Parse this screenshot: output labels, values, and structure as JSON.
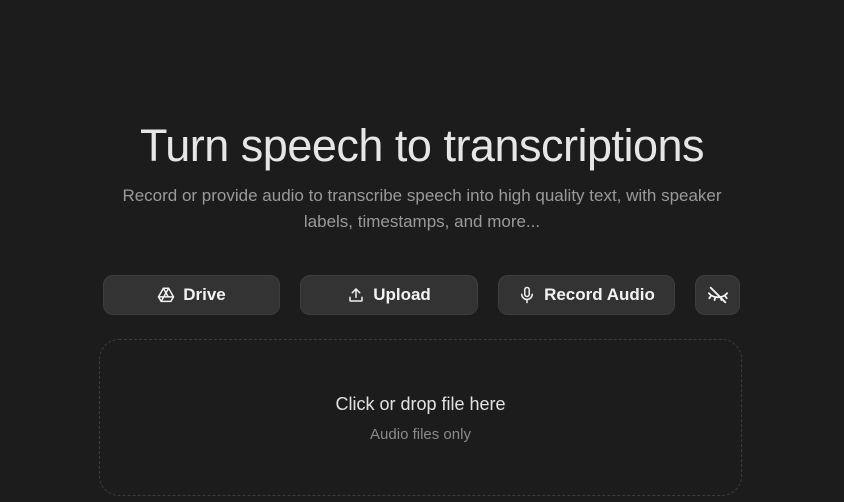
{
  "hero": {
    "title": "Turn speech to transcriptions",
    "subtitle": "Record or provide audio to transcribe speech into high quality text, with speaker labels, timestamps, and more..."
  },
  "actions": {
    "drive_label": "Drive",
    "drive_icon": "google-drive-icon",
    "upload_label": "Upload",
    "upload_icon": "upload-icon",
    "record_label": "Record Audio",
    "record_icon": "microphone-icon",
    "hide_icon": "eye-off-icon"
  },
  "dropzone": {
    "title": "Click or drop file here",
    "subtitle": "Audio files only"
  },
  "colors": {
    "background": "#1c1c1c",
    "button": "#333333",
    "text": "#e6e6e6",
    "muted": "#9a9a9a"
  }
}
